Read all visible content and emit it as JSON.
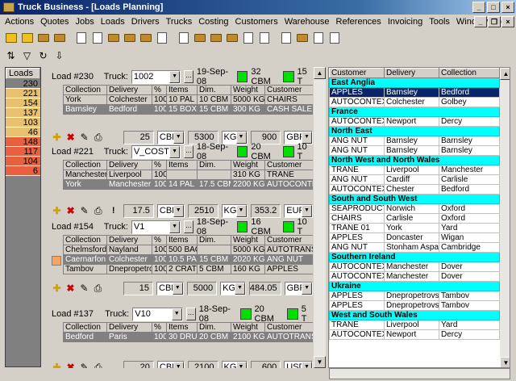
{
  "window": {
    "title": "Truck Business - [Loads Planning]"
  },
  "menu": [
    "Actions",
    "Quotes",
    "Jobs",
    "Loads",
    "Drivers",
    "Trucks",
    "Costing",
    "Customers",
    "Warehouse",
    "References",
    "Invoicing",
    "Tools",
    "Window",
    "Help"
  ],
  "loads": {
    "header": "Loads",
    "values": [
      "230",
      "221",
      "154",
      "137",
      "103",
      "46",
      "148",
      "117",
      "104",
      "6"
    ],
    "colors": [
      "#808080",
      "#e8c070",
      "#e8c070",
      "#e8c070",
      "#e8c070",
      "#e8c070",
      "#e86040",
      "#e86040",
      "#e86040",
      "#e86040"
    ]
  },
  "blocks": [
    {
      "load": "Load #230",
      "truck_label": "Truck:",
      "truck": "1002",
      "date": "19-Sep-08",
      "cbm": "32 CBM",
      "t": "15 T",
      "cols": [
        "Collection",
        "Delivery",
        "%",
        "Items",
        "Dim.",
        "Weight",
        "Customer"
      ],
      "rows": [
        [
          "York",
          "Colchester",
          "100",
          "10 PAL",
          "10 CBM",
          "5000 KG",
          "CHAIRS"
        ],
        [
          "Barnsley",
          "Bedford",
          "100",
          "15 BOX",
          "15 CBM",
          "300 KG",
          "CASH SALE"
        ]
      ],
      "sel": [
        1
      ],
      "mark": [],
      "foot": {
        "qty": "25",
        "u1": "CBM",
        "kg": "5300",
        "u2": "KG",
        "cost": "900",
        "cur": "GBP"
      }
    },
    {
      "load": "Load #221",
      "truck_label": "Truck:",
      "truck": "V_COST",
      "date": "18-Sep-08",
      "cbm": "20 CBM",
      "t": "10 T",
      "cols": [
        "Collection",
        "Delivery",
        "%",
        "Items",
        "Dim.",
        "Weight",
        "Customer"
      ],
      "rows": [
        [
          "Manchester",
          "Liverpool",
          "100",
          "",
          "",
          "310 KG",
          "TRANE"
        ],
        [
          "York",
          "Manchester",
          "100",
          "14 PAL",
          "17.5 CBM",
          "2200 KG",
          "AUTOCONTEX"
        ]
      ],
      "sel": [
        1
      ],
      "mark": [],
      "foot": {
        "warn": "!",
        "qty": "17.5",
        "u1": "CBM",
        "kg": "2510",
        "u2": "KG",
        "cost": "353.2",
        "cur": "EUR"
      }
    },
    {
      "load": "Load #154",
      "truck_label": "Truck:",
      "truck": "V1",
      "date": "18-Sep-08",
      "cbm": "16 CBM",
      "t": "10 T",
      "cols": [
        "Collection",
        "Delivery",
        "%",
        "Items",
        "Dim.",
        "Weight",
        "Customer"
      ],
      "rows": [
        [
          "Chelmsford",
          "Nayland",
          "100",
          "500 BAG",
          "",
          "5000 KG",
          "AUTOTRANS"
        ],
        [
          "Caernarfon",
          "Colchester",
          "100",
          "10.5 PAL",
          "15 CBM",
          "2020 KG",
          "ANG NUT"
        ],
        [
          "Tambov",
          "Dnepropetrovsk",
          "100",
          "2 CRATE",
          "5 CBM",
          "160 KG",
          "APPLES"
        ]
      ],
      "sel": [
        1
      ],
      "mark": [
        1
      ],
      "foot": {
        "qty": "15",
        "u1": "CBM",
        "kg": "5000",
        "u2": "KG",
        "cost": "484.05",
        "cur": "GBP"
      }
    },
    {
      "load": "Load #137",
      "truck_label": "Truck:",
      "truck": "V10",
      "date": "18-Sep-08",
      "cbm": "20 CBM",
      "t": "5 T",
      "cols": [
        "Collection",
        "Delivery",
        "%",
        "Items",
        "Dim.",
        "Weight",
        "Customer"
      ],
      "rows": [
        [
          "Bedford",
          "Paris",
          "100",
          "30 DRUM",
          "20 CBM",
          "2100 KG",
          "AUTOTRANS"
        ]
      ],
      "sel": [
        0
      ],
      "mark": [],
      "foot": {
        "qty": "20",
        "u1": "CBM",
        "kg": "2100",
        "u2": "KG",
        "cost": "600",
        "cur": "USD"
      }
    }
  ],
  "right": {
    "cols": [
      "Customer",
      "Delivery",
      "Collection"
    ],
    "rows": [
      {
        "g": "East Anglia"
      },
      {
        "r": [
          "APPLES",
          "Barnsley",
          "Bedford"
        ],
        "hl": true
      },
      {
        "r": [
          "AUTOCONTEX",
          "Colchester",
          "Golbey"
        ]
      },
      {
        "g": "France"
      },
      {
        "r": [
          "AUTOCONTEX",
          "Newport",
          "Dercy"
        ]
      },
      {
        "g": "North East"
      },
      {
        "r": [
          "ANG NUT",
          "Barnsley",
          "Barnsley"
        ]
      },
      {
        "r": [
          "ANG NUT",
          "Barnsley",
          "Barnsley"
        ]
      },
      {
        "g": "North West and North Wales"
      },
      {
        "r": [
          "TRANE",
          "Liverpool",
          "Manchester"
        ]
      },
      {
        "r": [
          "ANG NUT",
          "Cardiff",
          "Carlisle"
        ]
      },
      {
        "r": [
          "AUTOCONTEX",
          "Chester",
          "Bedford"
        ]
      },
      {
        "g": "South and South West"
      },
      {
        "r": [
          "SEAPRODUCT",
          "Norwich",
          "Oxford"
        ]
      },
      {
        "r": [
          "CHAIRS",
          "Carlisle",
          "Oxford"
        ]
      },
      {
        "r": [
          "TRANE 01",
          "York",
          "Yard"
        ]
      },
      {
        "r": [
          "APPLES",
          "Doncaster",
          "Wigan"
        ]
      },
      {
        "r": [
          "ANG NUT",
          "Stonham Aspal",
          "Cambridge"
        ]
      },
      {
        "g": "Southern Ireland"
      },
      {
        "r": [
          "AUTOCONTEX",
          "Manchester",
          "Dover"
        ]
      },
      {
        "r": [
          "AUTOCONTEX",
          "Manchester",
          "Dover"
        ]
      },
      {
        "g": "Ukraine"
      },
      {
        "r": [
          "APPLES",
          "Dnepropetrovsk",
          "Tambov"
        ]
      },
      {
        "r": [
          "APPLES",
          "Dnepropetrovsk",
          "Tambov"
        ]
      },
      {
        "g": "West and South Wales"
      },
      {
        "r": [
          "TRANE",
          "Liverpool",
          "Yard"
        ]
      },
      {
        "r": [
          "AUTOCONTEX",
          "Newport",
          "Dercy"
        ]
      }
    ]
  }
}
